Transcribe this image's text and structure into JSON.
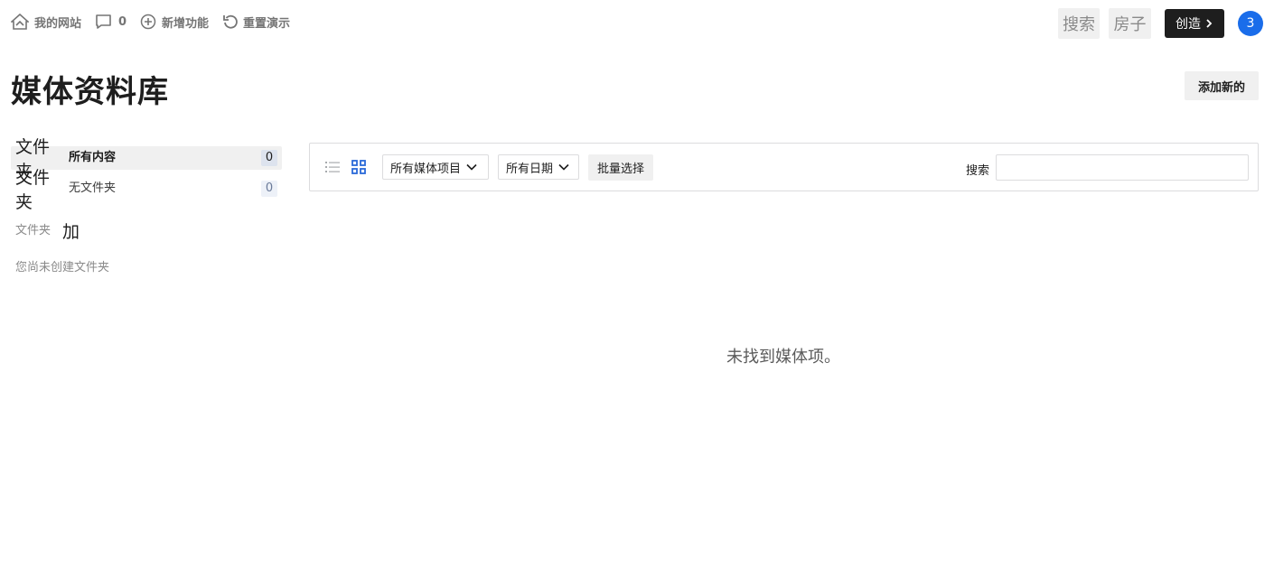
{
  "topbar": {
    "site_name": "我的网站",
    "comments_count": "0",
    "new_label": "新增功能",
    "reset_label": "重置演示",
    "search_label": "搜索",
    "house_label": "房子",
    "create_label": "创造",
    "notification_count": "3",
    "notification_color": "#1a6dea"
  },
  "header": {
    "title": "媒体资料库",
    "add_new_label": "添加新的"
  },
  "folders": {
    "items": [
      {
        "icon_text": "文件夹",
        "label": "所有内容",
        "count": "0"
      },
      {
        "icon_text": "文件夹",
        "label": "无文件夹",
        "count": "0"
      }
    ],
    "section_label": "文件夹",
    "add_label": "加",
    "empty_text": "您尚未创建文件夹"
  },
  "toolbar": {
    "media_type_selected": "所有媒体项目",
    "date_selected": "所有日期",
    "bulk_select_label": "批量选择",
    "search_label": "搜索",
    "search_value": ""
  },
  "main": {
    "empty_message": "未找到媒体项。"
  }
}
